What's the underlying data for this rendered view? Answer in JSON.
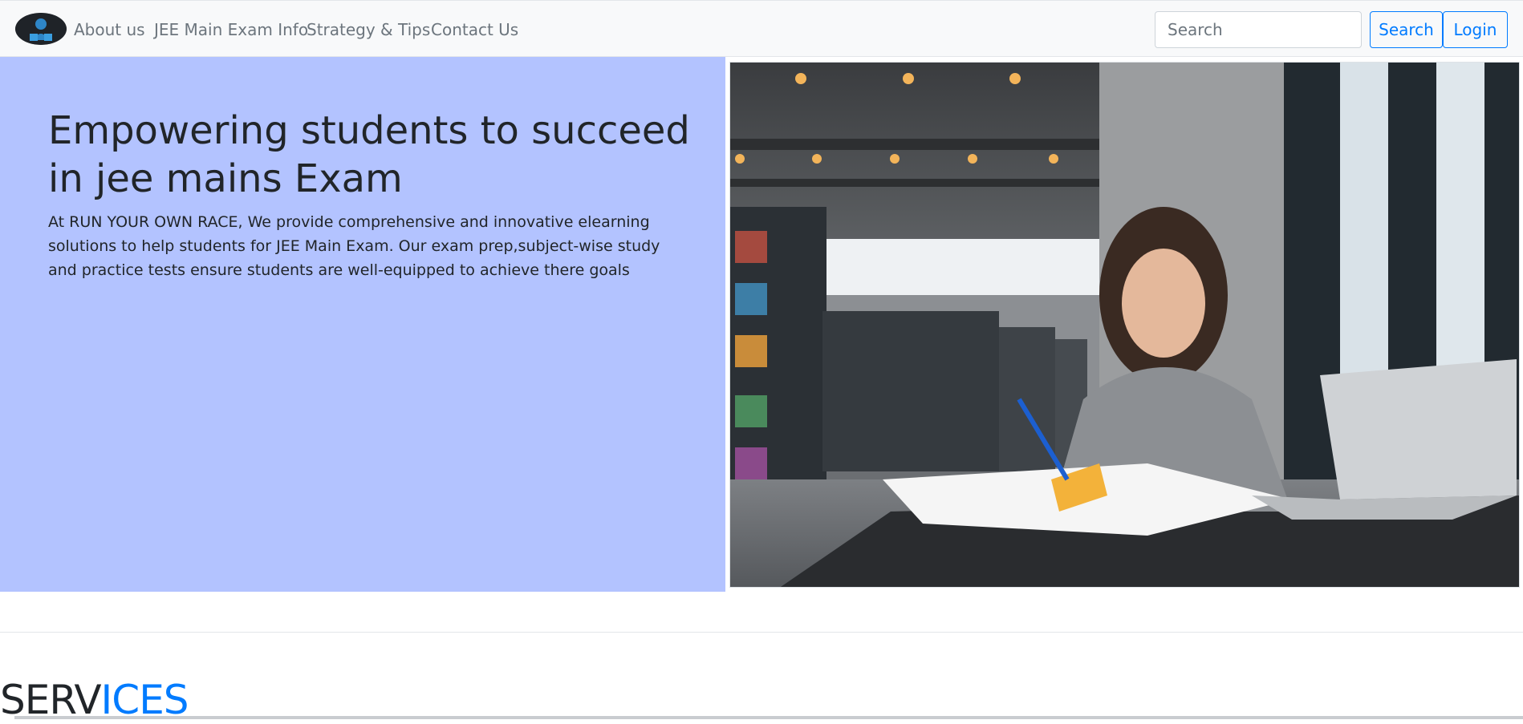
{
  "nav": {
    "logo": "logo",
    "links": [
      "About us",
      "JEE Main Exam Info",
      "Strategy & Tips",
      "Contact Us"
    ],
    "search_placeholder": "Search",
    "search_button": "Search",
    "login_button": "Login"
  },
  "hero": {
    "title": "Empowering students to succeed in jee mains Exam",
    "text": "At RUN YOUR OWN RACE, We provide comprehensive and innovative elearning solutions to help students for JEE Main Exam. Our exam prep,subject-wise study and practice tests ensure students are well-equipped to achieve there goals",
    "image": "student-studying-library-photo"
  },
  "services": {
    "title_part1": "SERV",
    "title_part2": "ICES"
  },
  "colors": {
    "hero_bg": "#b3c3ff",
    "accent": "#007bff",
    "nav_bg": "#f8f9fa"
  }
}
